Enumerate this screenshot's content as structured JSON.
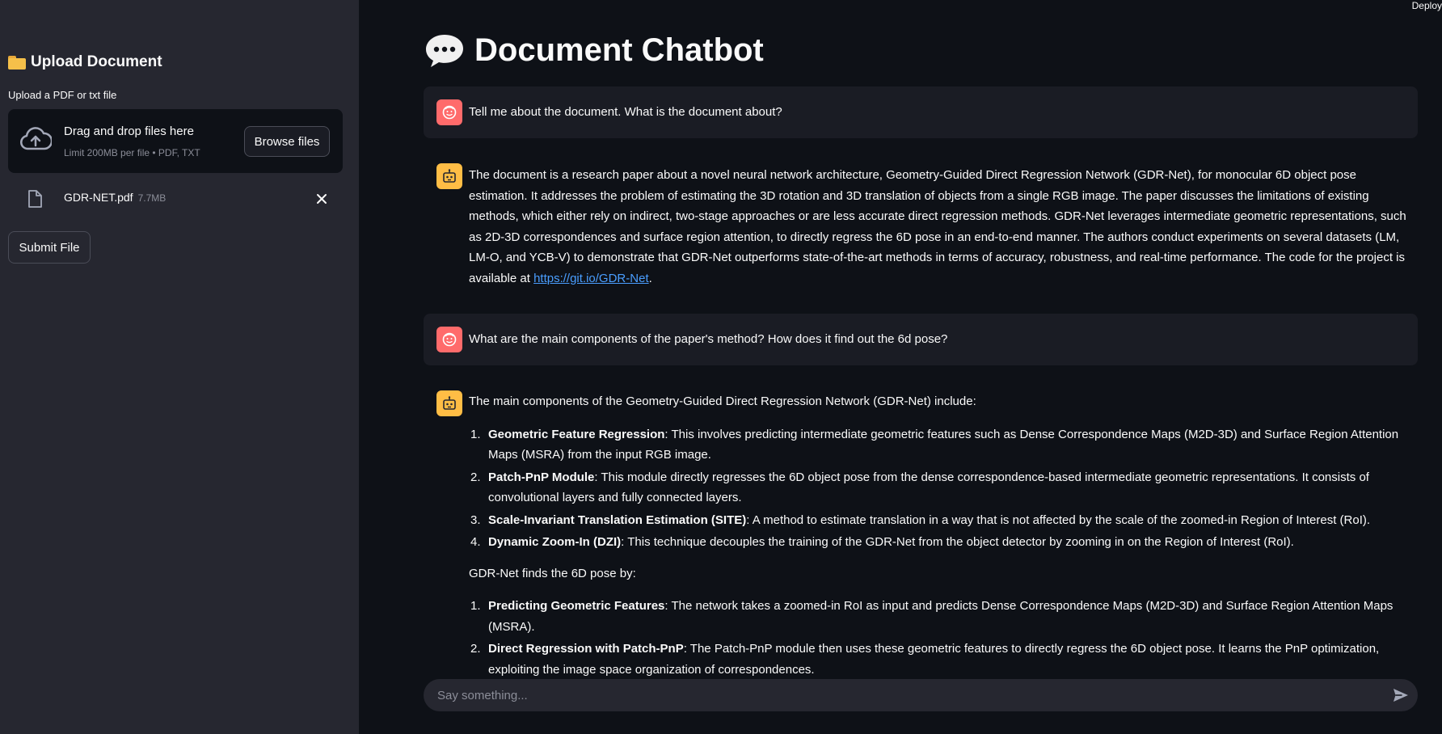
{
  "sidebar": {
    "title": "Upload Document",
    "uploader_label": "Upload a PDF or txt file",
    "dropzone_title": "Drag and drop files here",
    "dropzone_limit": "Limit 200MB per file • PDF, TXT",
    "browse_label": "Browse files",
    "file": {
      "name": "GDR-NET.pdf",
      "size": "7.7MB"
    },
    "submit_label": "Submit File"
  },
  "header": {
    "deploy_label": "Deploy"
  },
  "main": {
    "title": "Document Chatbot",
    "messages": [
      {
        "role": "user",
        "text": "Tell me about the document. What is the document about?"
      },
      {
        "role": "assistant",
        "text": "The document is a research paper about a novel neural network architecture, Geometry-Guided Direct Regression Network (GDR-Net), for monocular 6D object pose estimation. It addresses the problem of estimating the 3D rotation and 3D translation of objects from a single RGB image. The paper discusses the limitations of existing methods, which either rely on indirect, two-stage approaches or are less accurate direct regression methods. GDR-Net leverages intermediate geometric representations, such as 2D-3D correspondences and surface region attention, to directly regress the 6D pose in an end-to-end manner. The authors conduct experiments on several datasets (LM, LM-O, and YCB-V) to demonstrate that GDR-Net outperforms state-of-the-art methods in terms of accuracy, robustness, and real-time performance. The code for the project is available at ",
        "link": "https://git.io/GDR-Net",
        "trailing": "."
      },
      {
        "role": "user",
        "text": "What are the main components of the paper's method? How does it find out the 6d pose?"
      },
      {
        "role": "assistant",
        "intro": "The main components of the Geometry-Guided Direct Regression Network (GDR-Net) include:",
        "list1": [
          {
            "num": "1.",
            "term": "Geometric Feature Regression",
            "desc": ": This involves predicting intermediate geometric features such as Dense Correspondence Maps (M2D-3D) and Surface Region Attention Maps (MSRA) from the input RGB image."
          },
          {
            "num": "2.",
            "term": "Patch-PnP Module",
            "desc": ": This module directly regresses the 6D object pose from the dense correspondence-based intermediate geometric representations. It consists of convolutional layers and fully connected layers."
          },
          {
            "num": "3.",
            "term": "Scale-Invariant Translation Estimation (SITE)",
            "desc": ": A method to estimate translation in a way that is not affected by the scale of the zoomed-in Region of Interest (RoI)."
          },
          {
            "num": "4.",
            "term": "Dynamic Zoom-In (DZI)",
            "desc": ": This technique decouples the training of the GDR-Net from the object detector by zooming in on the Region of Interest (RoI)."
          }
        ],
        "middle": "GDR-Net finds the 6D pose by:",
        "list2": [
          {
            "num": "1.",
            "term": "Predicting Geometric Features",
            "desc": ": The network takes a zoomed-in RoI as input and predicts Dense Correspondence Maps (M2D-3D) and Surface Region Attention Maps (MSRA)."
          },
          {
            "num": "2.",
            "term": "Direct Regression with Patch-PnP",
            "desc": ": The Patch-PnP module then uses these geometric features to directly regress the 6D object pose. It learns the PnP optimization, exploiting the image space organization of correspondences."
          }
        ]
      }
    ]
  },
  "chat_input": {
    "placeholder": "Say something..."
  },
  "colors": {
    "background": "#0e1117",
    "sidebar": "#262730",
    "user_avatar": "#ff6b6b",
    "bot_avatar": "#ffbd45",
    "link": "#4a9eff"
  },
  "icons": [
    "folder-icon",
    "cloud-upload-icon",
    "file-icon",
    "close-icon",
    "speech-bubble-icon",
    "user-avatar-icon",
    "bot-avatar-icon",
    "send-icon"
  ]
}
